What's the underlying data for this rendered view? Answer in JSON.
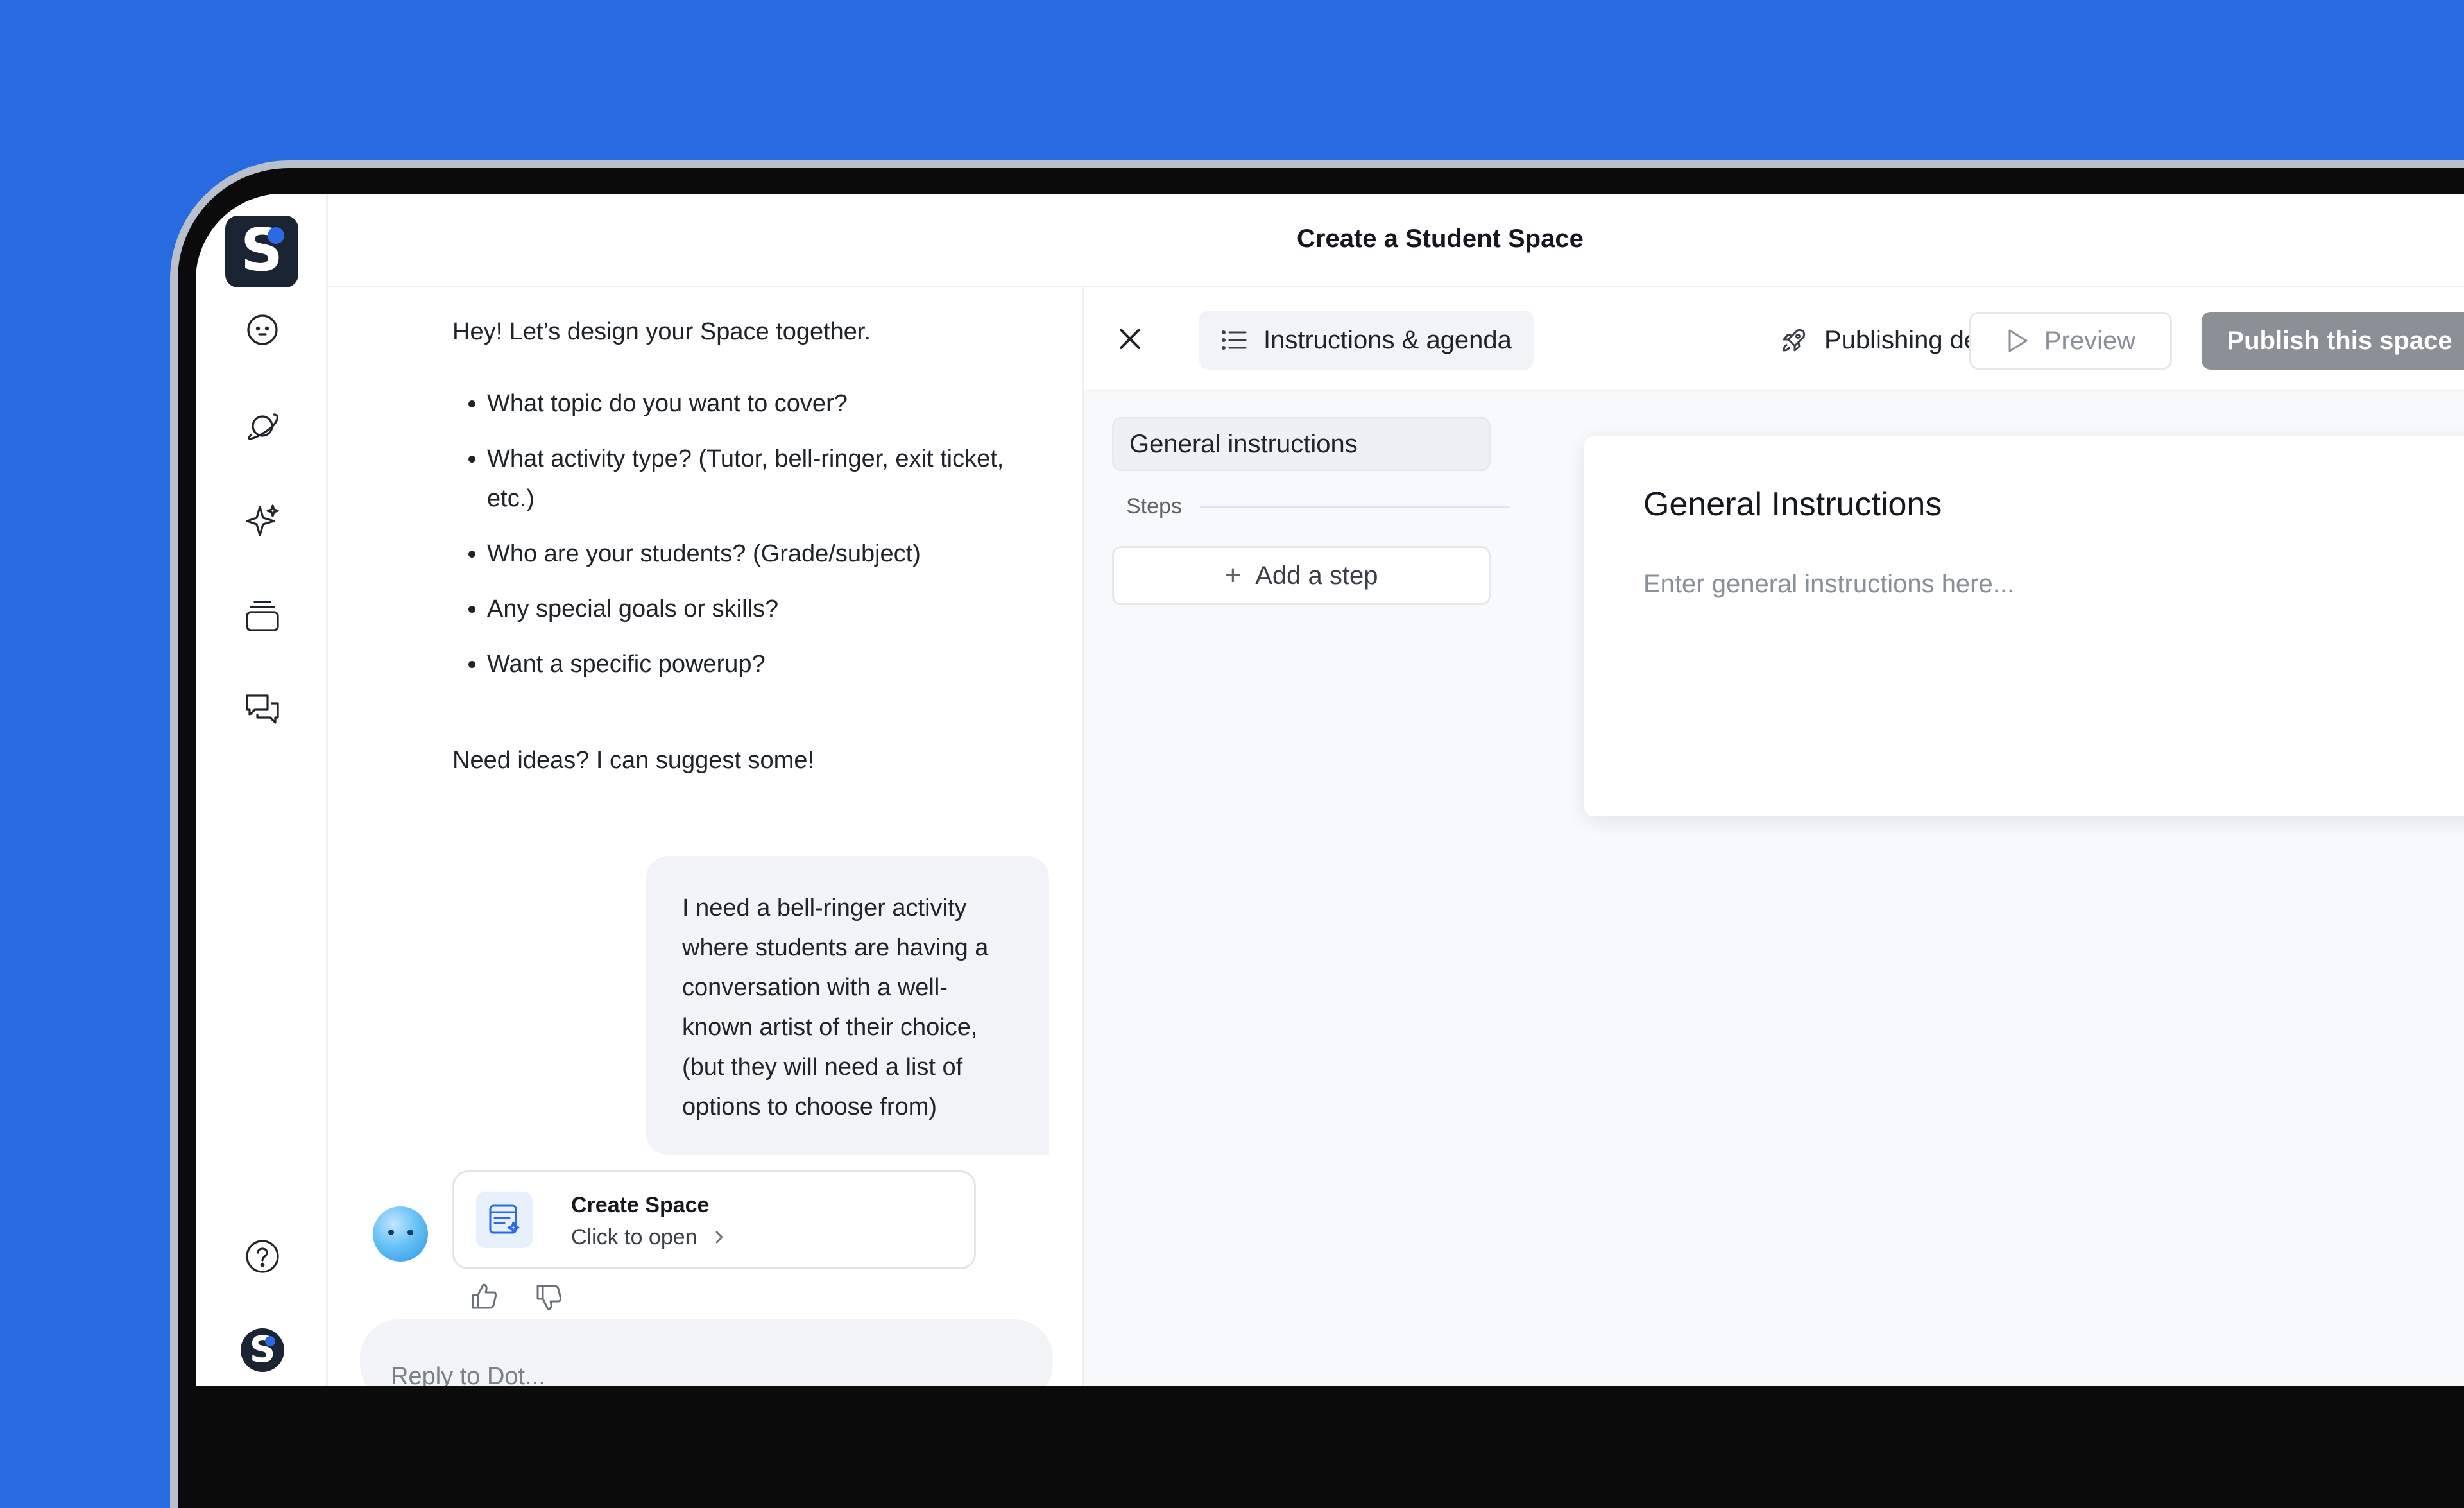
{
  "header": {
    "title": "Create a Student Space"
  },
  "rail": {
    "icons": [
      "smiley-face-icon",
      "planet-icon",
      "sparkle-icon",
      "stack-icon",
      "chat-bubbles-icon",
      "help-icon"
    ]
  },
  "chat": {
    "intro": "Hey! Let’s design your Space together.",
    "questions": [
      "What topic do you want to cover?",
      "What activity type? (Tutor, bell-ringer, exit ticket, etc.)",
      "Who are your students? (Grade/subject)",
      "Any special goals or skills?",
      "Want a specific powerup?"
    ],
    "ideas": "Need ideas? I can suggest some!",
    "user_message": "I need a bell-ringer activity where students are having a conversation with a well-known artist of their choice, (but they will need a list of options to choose from)",
    "card": {
      "title": "Create Space",
      "subtitle": "Click to open"
    },
    "reply_placeholder": "Reply to Dot..."
  },
  "editor": {
    "tabs": [
      {
        "label": "Instructions & agenda",
        "active": true
      },
      {
        "label": "Publishing details",
        "active": false
      }
    ],
    "preview_label": "Preview",
    "publish_label": "Publish this space",
    "sidebar": {
      "general_item": "General instructions",
      "steps_label": "Steps",
      "add_step_label": "Add a step"
    },
    "doc": {
      "title": "General Instructions",
      "placeholder": "Enter general instructions here..."
    }
  },
  "colors": {
    "background": "#286BE0",
    "logo": "#1B2433",
    "accent": "#2A6AE6",
    "publish_disabled": "#8B9096"
  }
}
